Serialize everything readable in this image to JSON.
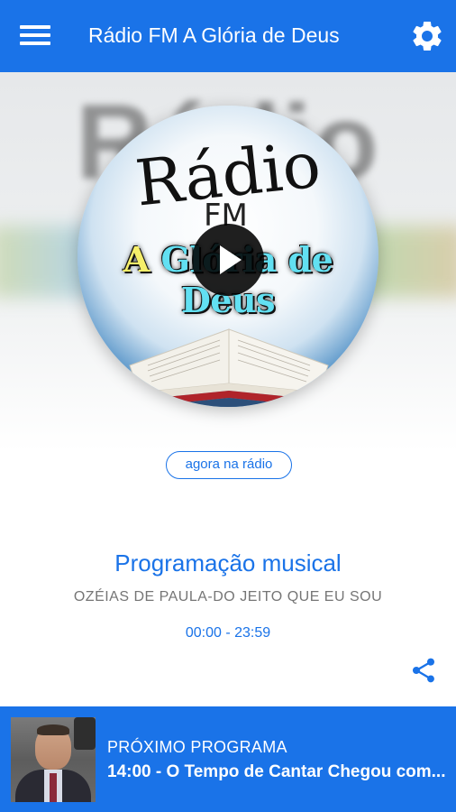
{
  "app": {
    "title": "Rádio FM A Glória de Deus",
    "accent_color": "#1a73e8",
    "menu_icon": "hamburger-menu-icon",
    "settings_icon": "gear-icon"
  },
  "hero": {
    "cover_line1": "Rádio",
    "cover_line2": "FM",
    "cover_line3_a": "A ",
    "cover_line3_b": "Glória de Deus",
    "play_icon": "play-icon"
  },
  "now_playing": {
    "chip_label": "agora na rádio",
    "program_title": "Programação musical",
    "song": "OZÉIAS DE PAULA-DO JEITO QUE EU SOU",
    "time_range": "00:00 - 23:59",
    "share_icon": "share-icon"
  },
  "next_program": {
    "label": "PRÓXIMO PROGRAMA",
    "title": "14:00 - O Tempo de Cantar Chegou com...",
    "thumbnail": "host-photo"
  }
}
